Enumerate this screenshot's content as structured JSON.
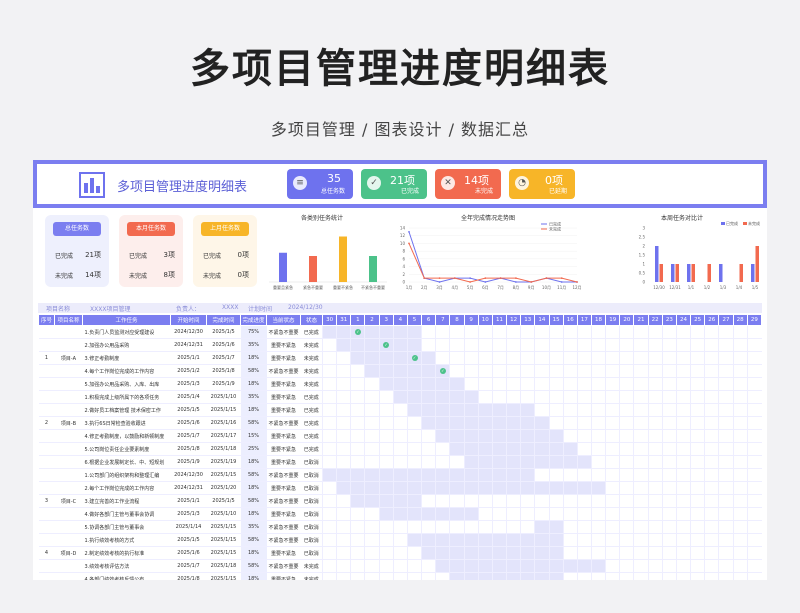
{
  "header": {
    "title": "多项目管理进度明细表",
    "subtitle": "多项目管理 / 图表设计 / 数据汇总"
  },
  "banner": {
    "title": "多项目管理进度明细表"
  },
  "kpis": [
    {
      "num": "35",
      "label": "总任务数",
      "color": "#6e72ee",
      "icon": "list-icon"
    },
    {
      "num": "21项",
      "label": "已完成",
      "color": "#4cc28a",
      "icon": "check-icon"
    },
    {
      "num": "14项",
      "label": "未完成",
      "color": "#f26a4f",
      "icon": "cross-icon"
    },
    {
      "num": "0项",
      "label": "已延期",
      "color": "#f7b528",
      "icon": "clock-icon"
    }
  ],
  "cards": [
    {
      "head": "总任务数",
      "r1": "已完成",
      "v1": "21项",
      "r2": "未完成",
      "v2": "14项",
      "color": "#7b7ef0",
      "bg": "#eef0fd"
    },
    {
      "head": "本月任务数",
      "r1": "已完成",
      "v1": "3项",
      "r2": "未完成",
      "v2": "8项",
      "color": "#f26a4f",
      "bg": "#fdeeec"
    },
    {
      "head": "上月任务数",
      "r1": "已完成",
      "v1": "0项",
      "r2": "未完成",
      "v2": "0项",
      "color": "#f7b528",
      "bg": "#fef6e8"
    }
  ],
  "chart_data": [
    {
      "type": "bar",
      "title": "各类别任务统计",
      "categories": [
        "重要且紧急",
        "紧急不重要",
        "重要不紧急",
        "不紧急不重要"
      ],
      "values": [
        9,
        8,
        14,
        8
      ],
      "colors": [
        "#6e72ee",
        "#f26a4f",
        "#f7b528",
        "#4cc28a"
      ],
      "ylim": [
        0,
        16
      ]
    },
    {
      "type": "line",
      "title": "全年完成情况走势图",
      "categories": [
        "1月",
        "2月",
        "3月",
        "4月",
        "5月",
        "6月",
        "7月",
        "8月",
        "9月",
        "10月",
        "11月",
        "12月"
      ],
      "ylim": [
        0,
        14
      ],
      "yticks": [
        "0",
        "2",
        "4",
        "6",
        "8",
        "10",
        "12",
        "14"
      ],
      "series": [
        {
          "name": "已完成",
          "color": "#6e72ee",
          "values": [
            13,
            1,
            0,
            1,
            1,
            0,
            1,
            0,
            0,
            1,
            0,
            0
          ]
        },
        {
          "name": "未完成",
          "color": "#f26a4f",
          "values": [
            10,
            1,
            1,
            1,
            0,
            1,
            1,
            1,
            0,
            1,
            1,
            0
          ]
        }
      ]
    },
    {
      "type": "bar",
      "title": "本周任务对比计",
      "categories": [
        "12/30",
        "12/31",
        "1/1",
        "1/2",
        "1/3",
        "1/4",
        "1/5"
      ],
      "ylim": [
        0,
        3
      ],
      "yticks": [
        "0",
        "0.5",
        "1",
        "1.5",
        "2",
        "2.5",
        "3"
      ],
      "series": [
        {
          "name": "已完成",
          "color": "#6e72ee",
          "values": [
            2,
            1,
            1,
            0,
            1,
            0,
            1
          ]
        },
        {
          "name": "未完成",
          "color": "#f26a4f",
          "values": [
            1,
            1,
            1,
            1,
            0,
            1,
            2
          ]
        }
      ]
    }
  ],
  "info": {
    "name_label": "项目名称",
    "name_value": "XXXX项目管理",
    "owner_label": "负责人：",
    "owner_value": "XXXX",
    "plan_label": "计划时间",
    "plan_value": "2024/12/30"
  },
  "columns": [
    "序号",
    "项目名称",
    "工作任务",
    "开始时间",
    "完成时间",
    "完成进度",
    "当前状态",
    "状态"
  ],
  "days": [
    "30",
    "31",
    "1",
    "2",
    "3",
    "4",
    "5",
    "6",
    "7",
    "8",
    "9",
    "10",
    "11",
    "12",
    "13",
    "14",
    "15",
    "16",
    "17",
    "18",
    "19",
    "20",
    "21",
    "22",
    "23",
    "24",
    "25",
    "26",
    "27",
    "28",
    "29"
  ],
  "rows": [
    {
      "seq": "",
      "proj": "",
      "task": "1.负责门人员监测对应受理建设",
      "start": "2024/12/30",
      "end": "2025/1/5",
      "pct": "75%",
      "cur": "不紧急不重要",
      "st": "已完成",
      "bar": [
        0,
        6
      ],
      "chk": 2
    },
    {
      "seq": "",
      "proj": "",
      "task": "2.加强办公用品采购",
      "start": "2024/12/31",
      "end": "2025/1/6",
      "pct": "35%",
      "cur": "重要不紧急",
      "st": "未完成",
      "bar": [
        1,
        6
      ],
      "chk": 4
    },
    {
      "seq": "1",
      "proj": "项目-A",
      "task": "3.修正考勤制度",
      "start": "2025/1/1",
      "end": "2025/1/7",
      "pct": "18%",
      "cur": "重要不紧急",
      "st": "未完成",
      "bar": [
        2,
        7
      ],
      "chk": 6
    },
    {
      "seq": "",
      "proj": "",
      "task": "4.每个工作岗位完成的工作内容",
      "start": "2025/1/2",
      "end": "2025/1/8",
      "pct": "58%",
      "cur": "不紧急不重要",
      "st": "未完成",
      "bar": [
        3,
        8
      ],
      "chk": 8
    },
    {
      "seq": "",
      "proj": "",
      "task": "5.加强办公用品采购、入库、出库",
      "start": "2025/1/3",
      "end": "2025/1/9",
      "pct": "18%",
      "cur": "重要不紧急",
      "st": "未完成",
      "bar": [
        4,
        9
      ],
      "chk": -1
    },
    {
      "seq": "",
      "proj": "",
      "task": "1.积极完成上级所属下的各项任务",
      "start": "2025/1/4",
      "end": "2025/1/10",
      "pct": "35%",
      "cur": "重要不紧急",
      "st": "已完成",
      "bar": [
        5,
        10
      ],
      "chk": -1
    },
    {
      "seq": "",
      "proj": "",
      "task": "2.做好员工档案管理 技术保密工作",
      "start": "2025/1/5",
      "end": "2025/1/15",
      "pct": "18%",
      "cur": "重要不紧急",
      "st": "已完成",
      "bar": [
        6,
        14
      ],
      "chk": -1
    },
    {
      "seq": "2",
      "proj": "项目-B",
      "task": "3.执行6S日常检查验收跟进",
      "start": "2025/1/6",
      "end": "2025/1/16",
      "pct": "58%",
      "cur": "不紧急不重要",
      "st": "已完成",
      "bar": [
        7,
        15
      ],
      "chk": -1
    },
    {
      "seq": "",
      "proj": "",
      "task": "4.修正考勤制度，以鼓励和新顿制度",
      "start": "2025/1/7",
      "end": "2025/1/17",
      "pct": "15%",
      "cur": "重要不紧急",
      "st": "已完成",
      "bar": [
        8,
        16
      ],
      "chk": -1
    },
    {
      "seq": "",
      "proj": "",
      "task": "5.公司岗位责任企业要素制度",
      "start": "2025/1/8",
      "end": "2025/1/18",
      "pct": "25%",
      "cur": "重要不紧急",
      "st": "已完成",
      "bar": [
        9,
        17
      ],
      "chk": -1
    },
    {
      "seq": "",
      "proj": "",
      "task": "6.根据企业发展制定长、中、短规划",
      "start": "2025/1/9",
      "end": "2025/1/19",
      "pct": "18%",
      "cur": "重要不紧急",
      "st": "已取消",
      "bar": [
        10,
        18
      ],
      "chk": -1
    },
    {
      "seq": "",
      "proj": "",
      "task": "1.公司部门的组织架构和整理汇编",
      "start": "2024/12/30",
      "end": "2025/1/15",
      "pct": "58%",
      "cur": "不紧急不重要",
      "st": "已取消",
      "bar": [
        0,
        14
      ],
      "chk": -1
    },
    {
      "seq": "",
      "proj": "",
      "task": "2.每个工作岗位完成的工作内容",
      "start": "2024/12/31",
      "end": "2025/1/20",
      "pct": "18%",
      "cur": "重要不紧急",
      "st": "已取消",
      "bar": [
        1,
        19
      ],
      "chk": -1
    },
    {
      "seq": "3",
      "proj": "项目-C",
      "task": "3.建立完善的工作业流程",
      "start": "2025/1/1",
      "end": "2025/1/5",
      "pct": "58%",
      "cur": "不紧急不重要",
      "st": "已取消",
      "bar": [
        2,
        6
      ],
      "chk": -1
    },
    {
      "seq": "",
      "proj": "",
      "task": "4.做好各部门主管与董事会协调",
      "start": "2025/1/3",
      "end": "2025/1/10",
      "pct": "18%",
      "cur": "重要不紧急",
      "st": "已取消",
      "bar": [
        4,
        10
      ],
      "chk": -1
    },
    {
      "seq": "",
      "proj": "",
      "task": "5.协调各部门主管与董事会",
      "start": "2025/1/14",
      "end": "2025/1/15",
      "pct": "35%",
      "cur": "不紧急不重要",
      "st": "已取消",
      "bar": [
        15,
        16
      ],
      "chk": -1
    },
    {
      "seq": "",
      "proj": "",
      "task": "1.执行绩效考核的方式",
      "start": "2025/1/5",
      "end": "2025/1/15",
      "pct": "58%",
      "cur": "不紧急不重要",
      "st": "已取消",
      "bar": [
        6,
        16
      ],
      "chk": -1
    },
    {
      "seq": "4",
      "proj": "项目-D",
      "task": "2.制定绩效考核的执行标准",
      "start": "2025/1/6",
      "end": "2025/1/15",
      "pct": "18%",
      "cur": "重要不紧急",
      "st": "已取消",
      "bar": [
        7,
        16
      ],
      "chk": -1
    },
    {
      "seq": "",
      "proj": "",
      "task": "3.绩效考核评估方法",
      "start": "2025/1/7",
      "end": "2025/1/18",
      "pct": "58%",
      "cur": "不紧急不重要",
      "st": "未完成",
      "bar": [
        8,
        19
      ],
      "chk": -1
    },
    {
      "seq": "",
      "proj": "",
      "task": "4.各部门绩效考核反馈公布",
      "start": "2025/1/8",
      "end": "2025/1/15",
      "pct": "18%",
      "cur": "重要不紧急",
      "st": "未完成",
      "bar": [
        9,
        16
      ],
      "chk": -1
    }
  ]
}
